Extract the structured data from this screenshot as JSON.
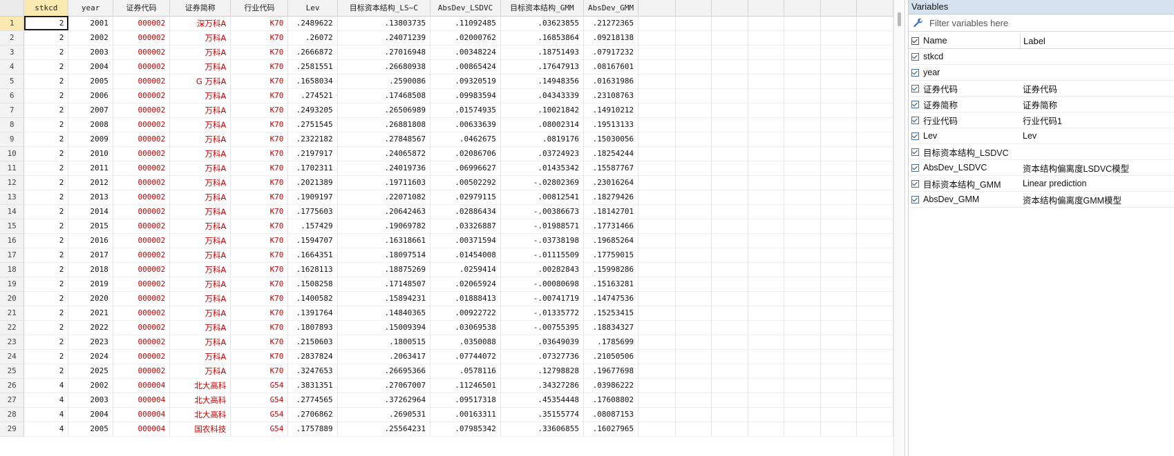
{
  "grid": {
    "columns": [
      "stkcd",
      "year",
      "证券代码",
      "证券简称",
      "行业代码",
      "Lev",
      "目标资本结构_LS~C",
      "AbsDev_LSDVC",
      "目标资本结构_GMM",
      "AbsDev_GMM"
    ],
    "rows": [
      {
        "n": "1",
        "c": [
          "2",
          "2001",
          "000002",
          "深万科A",
          "K70",
          ".2489622",
          ".13803735",
          ".11092485",
          ".03623855",
          ".21272365"
        ]
      },
      {
        "n": "2",
        "c": [
          "2",
          "2002",
          "000002",
          "万科A",
          "K70",
          ".26072",
          ".24071239",
          ".02000762",
          ".16853864",
          ".09218138"
        ]
      },
      {
        "n": "3",
        "c": [
          "2",
          "2003",
          "000002",
          "万科A",
          "K70",
          ".2666872",
          ".27016948",
          ".00348224",
          ".18751493",
          ".07917232"
        ]
      },
      {
        "n": "4",
        "c": [
          "2",
          "2004",
          "000002",
          "万科A",
          "K70",
          ".2581551",
          ".26680938",
          ".00865424",
          ".17647913",
          ".08167601"
        ]
      },
      {
        "n": "5",
        "c": [
          "2",
          "2005",
          "000002",
          "G 万科A",
          "K70",
          ".1658034",
          ".2590086",
          ".09320519",
          ".14948356",
          ".01631986"
        ]
      },
      {
        "n": "6",
        "c": [
          "2",
          "2006",
          "000002",
          "万科A",
          "K70",
          ".274521",
          ".17468508",
          ".09983594",
          ".04343339",
          ".23108763"
        ]
      },
      {
        "n": "7",
        "c": [
          "2",
          "2007",
          "000002",
          "万科A",
          "K70",
          ".2493205",
          ".26506989",
          ".01574935",
          ".10021842",
          ".14910212"
        ]
      },
      {
        "n": "8",
        "c": [
          "2",
          "2008",
          "000002",
          "万科A",
          "K70",
          ".2751545",
          ".26881808",
          ".00633639",
          ".08002314",
          ".19513133"
        ]
      },
      {
        "n": "9",
        "c": [
          "2",
          "2009",
          "000002",
          "万科A",
          "K70",
          ".2322182",
          ".27848567",
          ".0462675",
          ".0819176",
          ".15030056"
        ]
      },
      {
        "n": "10",
        "c": [
          "2",
          "2010",
          "000002",
          "万科A",
          "K70",
          ".2197917",
          ".24065872",
          ".02086706",
          ".03724923",
          ".18254244"
        ]
      },
      {
        "n": "11",
        "c": [
          "2",
          "2011",
          "000002",
          "万科A",
          "K70",
          ".1702311",
          ".24019736",
          ".06996627",
          ".01435342",
          ".15587767"
        ]
      },
      {
        "n": "12",
        "c": [
          "2",
          "2012",
          "000002",
          "万科A",
          "K70",
          ".2021389",
          ".19711603",
          ".00502292",
          "-.02802369",
          ".23016264"
        ]
      },
      {
        "n": "13",
        "c": [
          "2",
          "2013",
          "000002",
          "万科A",
          "K70",
          ".1909197",
          ".22071082",
          ".02979115",
          ".00812541",
          ".18279426"
        ]
      },
      {
        "n": "14",
        "c": [
          "2",
          "2014",
          "000002",
          "万科A",
          "K70",
          ".1775603",
          ".20642463",
          ".02886434",
          "-.00386673",
          ".18142701"
        ]
      },
      {
        "n": "15",
        "c": [
          "2",
          "2015",
          "000002",
          "万科A",
          "K70",
          ".157429",
          ".19069782",
          ".03326887",
          "-.01988571",
          ".17731466"
        ]
      },
      {
        "n": "16",
        "c": [
          "2",
          "2016",
          "000002",
          "万科A",
          "K70",
          ".1594707",
          ".16318661",
          ".00371594",
          "-.03738198",
          ".19685264"
        ]
      },
      {
        "n": "17",
        "c": [
          "2",
          "2017",
          "000002",
          "万科A",
          "K70",
          ".1664351",
          ".18097514",
          ".01454008",
          "-.01115509",
          ".17759015"
        ]
      },
      {
        "n": "18",
        "c": [
          "2",
          "2018",
          "000002",
          "万科A",
          "K70",
          ".1628113",
          ".18875269",
          ".0259414",
          ".00282843",
          ".15998286"
        ]
      },
      {
        "n": "19",
        "c": [
          "2",
          "2019",
          "000002",
          "万科A",
          "K70",
          ".1508258",
          ".17148507",
          ".02065924",
          "-.00080698",
          ".15163281"
        ]
      },
      {
        "n": "20",
        "c": [
          "2",
          "2020",
          "000002",
          "万科A",
          "K70",
          ".1400582",
          ".15894231",
          ".01888413",
          "-.00741719",
          ".14747536"
        ]
      },
      {
        "n": "21",
        "c": [
          "2",
          "2021",
          "000002",
          "万科A",
          "K70",
          ".1391764",
          ".14840365",
          ".00922722",
          "-.01335772",
          ".15253415"
        ]
      },
      {
        "n": "22",
        "c": [
          "2",
          "2022",
          "000002",
          "万科A",
          "K70",
          ".1807893",
          ".15009394",
          ".03069538",
          "-.00755395",
          ".18834327"
        ]
      },
      {
        "n": "23",
        "c": [
          "2",
          "2023",
          "000002",
          "万科A",
          "K70",
          ".2150603",
          ".1800515",
          ".0350088",
          ".03649039",
          ".1785699"
        ]
      },
      {
        "n": "24",
        "c": [
          "2",
          "2024",
          "000002",
          "万科A",
          "K70",
          ".2837824",
          ".2063417",
          ".07744072",
          ".07327736",
          ".21050506"
        ]
      },
      {
        "n": "25",
        "c": [
          "2",
          "2025",
          "000002",
          "万科A",
          "K70",
          ".3247653",
          ".26695366",
          ".0578116",
          ".12798828",
          ".19677698"
        ]
      },
      {
        "n": "26",
        "c": [
          "4",
          "2002",
          "000004",
          "北大高科",
          "G54",
          ".3831351",
          ".27067007",
          ".11246501",
          ".34327286",
          ".03986222"
        ]
      },
      {
        "n": "27",
        "c": [
          "4",
          "2003",
          "000004",
          "北大高科",
          "G54",
          ".2774565",
          ".37262964",
          ".09517318",
          ".45354448",
          ".17608802"
        ]
      },
      {
        "n": "28",
        "c": [
          "4",
          "2004",
          "000004",
          "北大高科",
          "G54",
          ".2706862",
          ".2690531",
          ".00163311",
          ".35155774",
          ".08087153"
        ]
      },
      {
        "n": "29",
        "c": [
          "4",
          "2005",
          "000004",
          "国农科技",
          "G54",
          ".1757889",
          ".25564231",
          ".07985342",
          ".33606855",
          ".16027965"
        ]
      }
    ]
  },
  "variables_panel": {
    "title": "Variables",
    "filter_placeholder": "Filter variables here",
    "header_name": "Name",
    "header_label": "Label",
    "items": [
      {
        "name": "stkcd",
        "label": ""
      },
      {
        "name": "year",
        "label": ""
      },
      {
        "name": "证券代码",
        "label": "证券代码"
      },
      {
        "name": "证券简称",
        "label": "证券简称"
      },
      {
        "name": "行业代码",
        "label": "行业代码1"
      },
      {
        "name": "Lev",
        "label": "Lev"
      },
      {
        "name": "目标资本结构_LSDVC",
        "label": ""
      },
      {
        "name": "AbsDev_LSDVC",
        "label": "资本结构偏离度LSDVC模型"
      },
      {
        "name": "目标资本结构_GMM",
        "label": "Linear prediction"
      },
      {
        "name": "AbsDev_GMM",
        "label": "资本结构偏离度GMM模型"
      }
    ]
  },
  "icons": {
    "filter_tool": "wrench-icon",
    "checkbox": "checkbox-checked-icon"
  }
}
